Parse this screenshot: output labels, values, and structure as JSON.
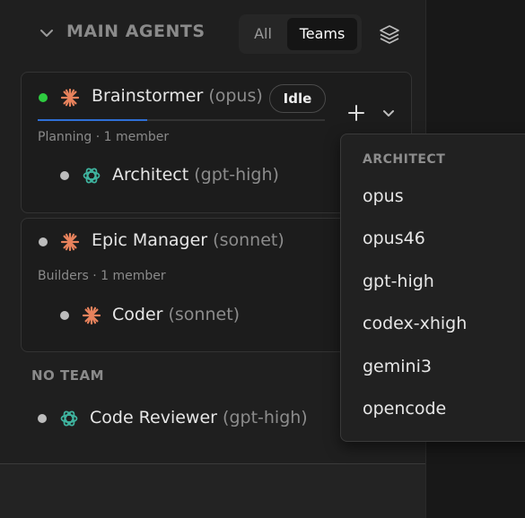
{
  "header": {
    "title": "MAIN AGENTS",
    "filter_all": "All",
    "filter_teams": "Teams"
  },
  "teams": [
    {
      "lead": {
        "name": "Brainstormer",
        "model": "(opus)",
        "status_dot": "#2ecc40",
        "icon": "claude-icon"
      },
      "status_badge": "Idle",
      "progress": 0.38,
      "subtitle": "Planning · 1 member",
      "members": [
        {
          "name": "Architect",
          "model": "(gpt-high)",
          "icon": "openai-icon"
        }
      ]
    },
    {
      "lead": {
        "name": "Epic Manager",
        "model": "(sonnet)",
        "status_dot": "#bdbdbd",
        "icon": "claude-icon"
      },
      "subtitle": "Builders · 1 member",
      "members": [
        {
          "name": "Coder",
          "model": "(sonnet)",
          "icon": "claude-icon"
        }
      ]
    }
  ],
  "no_team": {
    "label": "NO TEAM",
    "agents": [
      {
        "name": "Code Reviewer",
        "model": "(gpt-high)",
        "icon": "openai-icon"
      }
    ]
  },
  "model_menu": {
    "header": "ARCHITECT",
    "options": [
      "opus",
      "opus46",
      "gpt-high",
      "codex-xhigh",
      "gemini3",
      "opencode"
    ]
  },
  "colors": {
    "claude_accent": "#e8825c",
    "openai_accent": "#3fb5a0",
    "progress_accent": "#2f6fd6",
    "active_dot": "#2ecc40"
  }
}
